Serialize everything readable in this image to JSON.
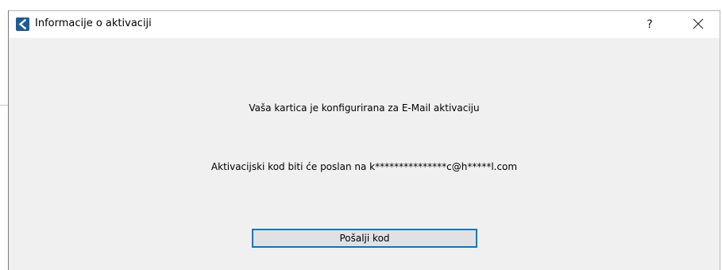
{
  "window": {
    "title": "Informacije o aktivaciji",
    "app_icon": "app-logo-icon",
    "help_label": "?",
    "close_icon": "close-icon"
  },
  "content": {
    "message_config": "Vaša kartica je konfigurirana za E-Mail aktivaciju",
    "message_sent": "Aktivacijski kod biti će poslan na k***************c@h*****l.com"
  },
  "actions": {
    "send_code_label": "Pošalji kod"
  },
  "colors": {
    "accent": "#0078d7",
    "app_icon": "#1f5a9b",
    "dialog_bg": "#f0f0f0"
  }
}
